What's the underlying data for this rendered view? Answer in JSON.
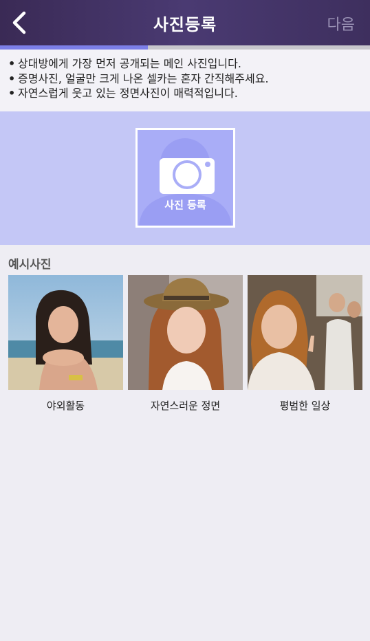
{
  "header": {
    "title": "사진등록",
    "next_label": "다음",
    "back_icon": "chevron-left-icon"
  },
  "progress": {
    "fraction": 0.4
  },
  "notice": {
    "lines": [
      "상대방에게 가장 먼저 공개되는 메인 사진입니다.",
      "증명사진, 얼굴만 크게 나온 셀카는 혼자 간직해주세요.",
      "자연스럽게 웃고 있는 정면사진이 매력적입니다."
    ]
  },
  "upload": {
    "label": "사진 등록",
    "icon": "camera-icon"
  },
  "examples": {
    "title": "예시사진",
    "items": [
      {
        "caption": "야외활동"
      },
      {
        "caption": "자연스러운 정면"
      },
      {
        "caption": "평범한 일상"
      }
    ]
  },
  "colors": {
    "header": "#3e2f5e",
    "progress_fill": "#7c7fe8",
    "upload_bg": "#c4c7f6",
    "upload_box": "#a9adf7"
  }
}
